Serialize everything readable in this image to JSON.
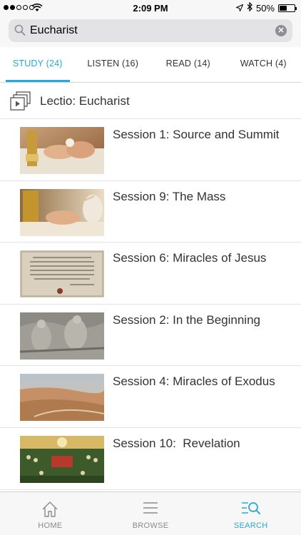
{
  "status_bar": {
    "time": "2:09 PM",
    "battery": "50%",
    "battery_level": 0.5,
    "signal_dots_filled": 2,
    "signal_dots_total": 5
  },
  "search": {
    "value": "Eucharist",
    "icons": [
      "search-icon",
      "clear-icon"
    ]
  },
  "tabs": [
    {
      "label": "STUDY (24)",
      "active": true
    },
    {
      "label": "LISTEN (16)",
      "active": false
    },
    {
      "label": "READ (14)",
      "active": false
    },
    {
      "label": "WATCH (4)",
      "active": false
    }
  ],
  "lectio": {
    "title": "Lectio: Eucharist",
    "icon": "video-stack-icon"
  },
  "sessions": [
    {
      "title": "Session 1: Source and Summit"
    },
    {
      "title": "Session 9: The Mass"
    },
    {
      "title": "Session 6: Miracles of Jesus"
    },
    {
      "title": "Session 2: In the Beginning"
    },
    {
      "title": "Session 4: Miracles of Exodus"
    },
    {
      "title": "Session 10:  Revelation"
    }
  ],
  "bottom_nav": [
    {
      "label": "HOME",
      "icon": "home-icon",
      "active": false
    },
    {
      "label": "BROWSE",
      "icon": "menu-icon",
      "active": false
    },
    {
      "label": "SEARCH",
      "icon": "search-list-icon",
      "active": true
    }
  ],
  "colors": {
    "accent": "#2aa7d5",
    "text": "#333333",
    "inactive": "#8a8a8a"
  }
}
